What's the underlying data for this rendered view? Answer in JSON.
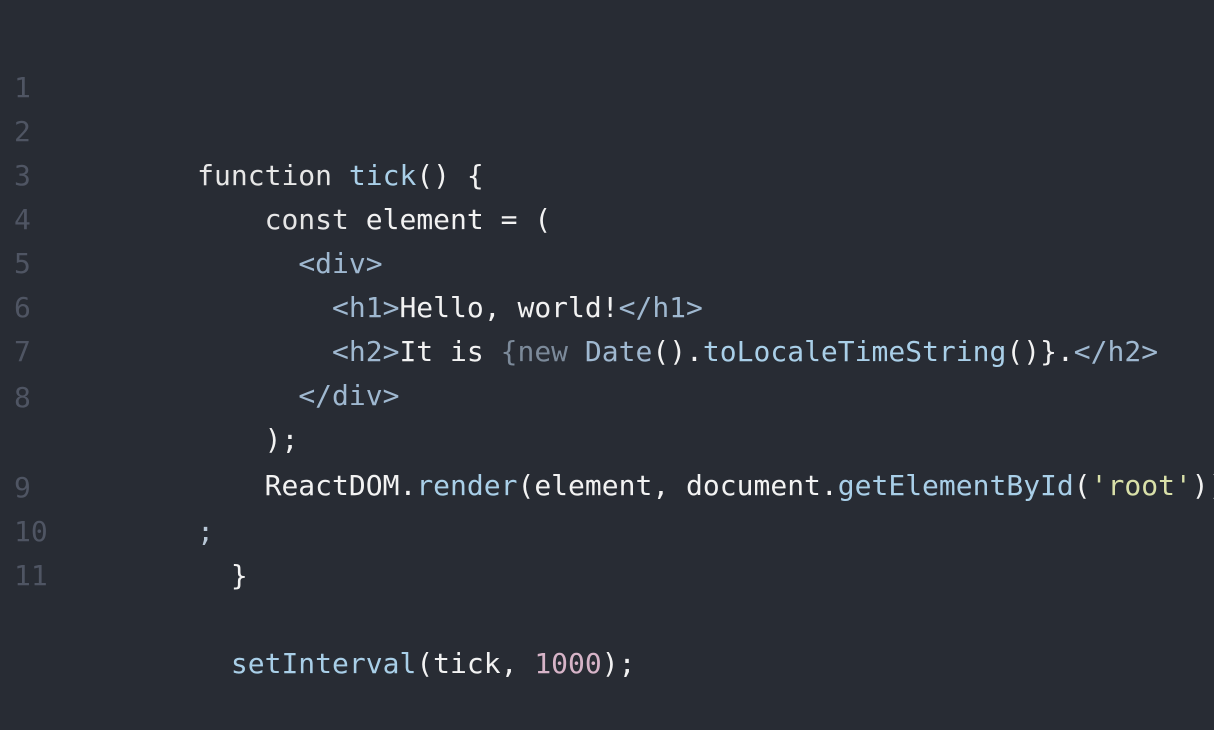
{
  "lines": [
    {
      "num": "1",
      "tokens": [
        "function",
        " ",
        "tick",
        "() {"
      ]
    },
    {
      "num": "2",
      "tokens": [
        "    ",
        "const",
        " element = ("
      ]
    },
    {
      "num": "3",
      "tokens": [
        "      ",
        "<div>"
      ]
    },
    {
      "num": "4",
      "tokens": [
        "        ",
        "<h1>",
        "Hello, world!",
        "</h1>"
      ]
    },
    {
      "num": "5",
      "tokens": [
        "        ",
        "<h2>",
        "It is ",
        "{new ",
        "Date",
        "().",
        "toLocaleTimeString",
        "()}",
        ".",
        "</h2>"
      ]
    },
    {
      "num": "6",
      "tokens": [
        "      ",
        "</div>"
      ]
    },
    {
      "num": "7",
      "tokens": [
        "    ",
        ");"
      ]
    },
    {
      "num": "8",
      "tokens": [
        "    ",
        "ReactDOM.",
        "render",
        "(element, document.",
        "getElementById",
        "(",
        "'root'",
        "))"
      ]
    },
    {
      "num": "",
      "tokens": [
        ";"
      ]
    },
    {
      "num": "9",
      "tokens": [
        "  ",
        "}"
      ]
    },
    {
      "num": "10",
      "tokens": [
        ""
      ]
    },
    {
      "num": "11",
      "tokens": [
        "  ",
        "setInterval",
        "(tick, ",
        "1000",
        ");"
      ]
    }
  ],
  "colors": {
    "background": "#282c34",
    "line_number": "#4f5563"
  }
}
